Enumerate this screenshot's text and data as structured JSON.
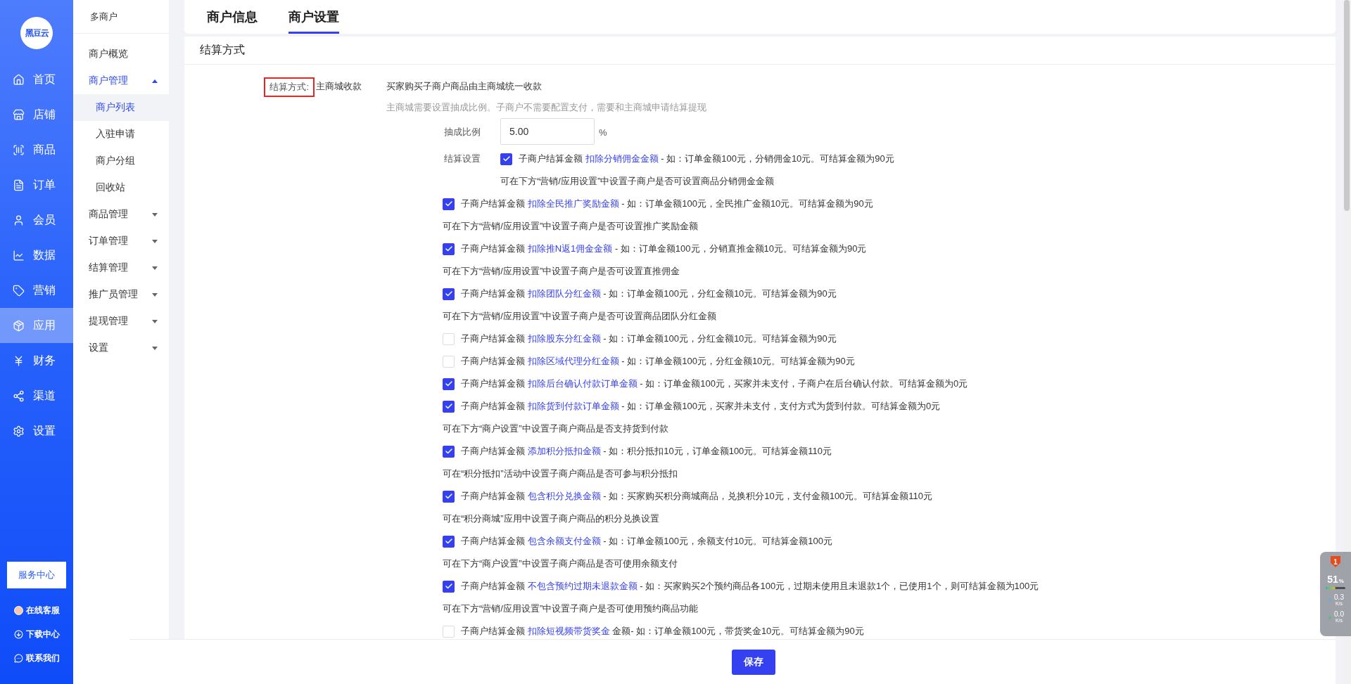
{
  "logo": "黑豆云",
  "nav": [
    {
      "label": "首页",
      "selected": false
    },
    {
      "label": "店铺",
      "selected": false
    },
    {
      "label": "商品",
      "selected": false
    },
    {
      "label": "订单",
      "selected": false
    },
    {
      "label": "会员",
      "selected": false
    },
    {
      "label": "数据",
      "selected": false
    },
    {
      "label": "营销",
      "selected": false
    },
    {
      "label": "应用",
      "selected": true
    },
    {
      "label": "财务",
      "selected": false
    },
    {
      "label": "渠道",
      "selected": false
    },
    {
      "label": "设置",
      "selected": false
    }
  ],
  "service_button": "服务中心",
  "bottom_links": [
    "在线客服",
    "下载中心",
    "联系我们"
  ],
  "subnav": {
    "title": "多商户",
    "items": [
      {
        "label": "商户概览"
      },
      {
        "label": "商户管理",
        "expanded": true,
        "children": [
          {
            "label": "商户列表",
            "selected": true
          },
          {
            "label": "入驻申请",
            "selected": false
          },
          {
            "label": "商户分组",
            "selected": false
          },
          {
            "label": "回收站",
            "selected": false
          }
        ]
      },
      {
        "label": "商品管理",
        "expanded": false
      },
      {
        "label": "订单管理",
        "expanded": false
      },
      {
        "label": "结算管理",
        "expanded": false
      },
      {
        "label": "推广员管理",
        "expanded": false
      },
      {
        "label": "提现管理",
        "expanded": false
      },
      {
        "label": "设置",
        "expanded": false
      }
    ]
  },
  "tabs": [
    {
      "label": "商户信息",
      "selected": false
    },
    {
      "label": "商户设置",
      "selected": true
    }
  ],
  "section_title": "结算方式",
  "form": {
    "label": "结算方式:",
    "highlighted": true,
    "value": "主商城收款",
    "description": "买家购买子商户商品由主商城统一收款",
    "hint": "主商城需要设置抽成比例。子商户不需要配置支付，需要和主商城申请结算提现",
    "rate": {
      "label": "抽成比例",
      "value": "5.00",
      "unit": "%"
    },
    "settings_label": "结算设置",
    "inline_rules": [
      {
        "kind": "check",
        "checked": true,
        "text": "子商户结算金额",
        "link": "扣除分销佣金金额",
        "detail": "- 如：订单金额100元，分销佣金10元。可结算金额为90元"
      },
      {
        "kind": "note",
        "text": "可在下方“营销/应用设置”中设置子商户是否可设置商品分销佣金金额"
      }
    ],
    "rules": [
      {
        "kind": "check",
        "checked": true,
        "text": "子商户结算金额",
        "link": "扣除全民推广奖励金额",
        "detail": "- 如：订单金额100元，全民推广金额10元。可结算金额为90元"
      },
      {
        "kind": "note",
        "text": "可在下方“营销/应用设置”中设置子商户是否可设置推广奖励金额"
      },
      {
        "kind": "check",
        "checked": true,
        "text": "子商户结算金额",
        "link": "扣除推N返1佣金金额",
        "detail": "- 如：订单金额100元，分销直推金额10元。可结算金额为90元"
      },
      {
        "kind": "note",
        "text": "可在下方“营销/应用设置”中设置子商户是否可设置直推佣金"
      },
      {
        "kind": "check",
        "checked": true,
        "text": "子商户结算金额",
        "link": "扣除团队分红金额",
        "detail": "- 如：订单金额100元，分红金额10元。可结算金额为90元"
      },
      {
        "kind": "note",
        "text": "可在下方“营销/应用设置”中设置子商户是否可设置商品团队分红金额"
      },
      {
        "kind": "check",
        "checked": false,
        "text": "子商户结算金额",
        "link": "扣除股东分红金额",
        "detail": "- 如：订单金额100元，分红金额10元。可结算金额为90元"
      },
      {
        "kind": "check",
        "checked": false,
        "text": "子商户结算金额",
        "link": "扣除区域代理分红金额",
        "detail": "- 如：订单金额100元，分红金额10元。可结算金额为90元"
      },
      {
        "kind": "check",
        "checked": true,
        "text": "子商户结算金额",
        "link": "扣除后台确认付款订单金额",
        "detail": "- 如：订单金额100元，买家并未支付，子商户在后台确认付款。可结算金额为0元"
      },
      {
        "kind": "check",
        "checked": true,
        "text": "子商户结算金额",
        "link": "扣除货到付款订单金额",
        "detail": "- 如：订单金额100元，买家并未支付，支付方式为货到付款。可结算金额为0元"
      },
      {
        "kind": "note",
        "text": "可在下方“商户设置”中设置子商户商品是否支持货到付款"
      },
      {
        "kind": "check",
        "checked": true,
        "text": "子商户结算金额",
        "link": "添加积分抵扣金额",
        "detail": "- 如：积分抵扣10元，订单金额100元。可结算金额110元"
      },
      {
        "kind": "note",
        "text": "可在“积分抵扣”活动中设置子商户商品是否可参与积分抵扣"
      },
      {
        "kind": "check",
        "checked": true,
        "text": "子商户结算金额",
        "link": "包含积分兑换金额",
        "detail": "- 如：买家购买积分商城商品，兑换积分10元，支付金额100元。可结算金额110元"
      },
      {
        "kind": "note",
        "text": "可在“积分商城”应用中设置子商户商品的积分兑换设置"
      },
      {
        "kind": "check",
        "checked": true,
        "text": "子商户结算金额",
        "link": "包含余额支付金额",
        "detail": "- 如：订单金额100元，余额支付10元。可结算金额100元"
      },
      {
        "kind": "note",
        "text": "可在下方“商户设置”中设置子商户商品是否可使用余额支付"
      },
      {
        "kind": "check",
        "checked": true,
        "text": "子商户结算金额",
        "link": "不包含预约过期未退款金额",
        "detail": "- 如：买家购买2个预约商品各100元，过期未使用且未退款1个，已使用1个，则可结算金额为100元"
      },
      {
        "kind": "note",
        "text": "可在下方“营销/应用设置”中设置子商户是否可使用预约商品功能"
      },
      {
        "kind": "check",
        "checked": false,
        "text": "子商户结算金额",
        "link": "扣除短视频带货奖金",
        "detail": "金额- 如：订单金额100元，带货奖金10元。可结算金额为90元"
      }
    ]
  },
  "save_button": "保存",
  "monitor": {
    "badge": "1",
    "percent": "51",
    "percent_unit": "%",
    "level": 0.51,
    "up": "0.3",
    "up_unit": "K/s",
    "down": "0.0",
    "down_unit": "K/s"
  }
}
